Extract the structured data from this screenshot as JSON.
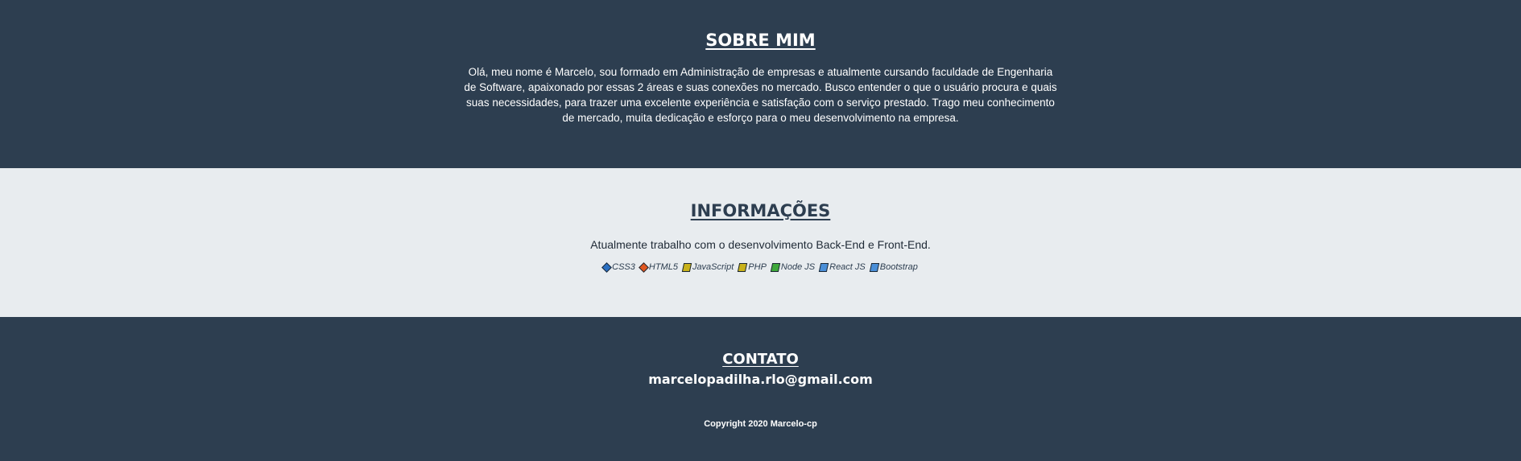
{
  "about": {
    "title": "SOBRE MIM",
    "text": "Olá, meu nome é Marcelo, sou formado em Administração de empresas e atualmente cursando faculdade de Engenharia de Software, apaixonado por essas 2 áreas e suas conexões no mercado. Busco entender o que o usuário procura e quais suas necessidades, para trazer uma excelente experiência e satisfação com o serviço prestado. Trago meu conhecimento de mercado, muita dedicação e esforço para o meu desenvolvimento na empresa."
  },
  "info": {
    "title": "INFORMAÇÕES",
    "text": "Atualmente trabalho com o desenvolvimento Back-End e Front-End.",
    "technologies": [
      {
        "label": "CSS3",
        "icon": "css3-icon",
        "color": "#2a6fc2"
      },
      {
        "label": "HTML5",
        "icon": "html5-icon",
        "color": "#e0561f"
      },
      {
        "label": "JavaScript",
        "icon": "javascript-icon",
        "color": "#c9b21a"
      },
      {
        "label": "PHP",
        "icon": "php-icon",
        "color": "#c9b21a"
      },
      {
        "label": "Node JS",
        "icon": "nodejs-icon",
        "color": "#3ea83a"
      },
      {
        "label": "React JS",
        "icon": "reactjs-icon",
        "color": "#4a8fd8"
      },
      {
        "label": "Bootstrap",
        "icon": "bootstrap-icon",
        "color": "#4a8fd8"
      }
    ]
  },
  "contact": {
    "title": "CONTATO",
    "email": "marcelopadilha.rlo@gmail.com",
    "copyright": "Copyright 2020 Marcelo-cp"
  },
  "colors": {
    "dark_background": "#2d3e50",
    "light_background": "#e8ecef"
  }
}
